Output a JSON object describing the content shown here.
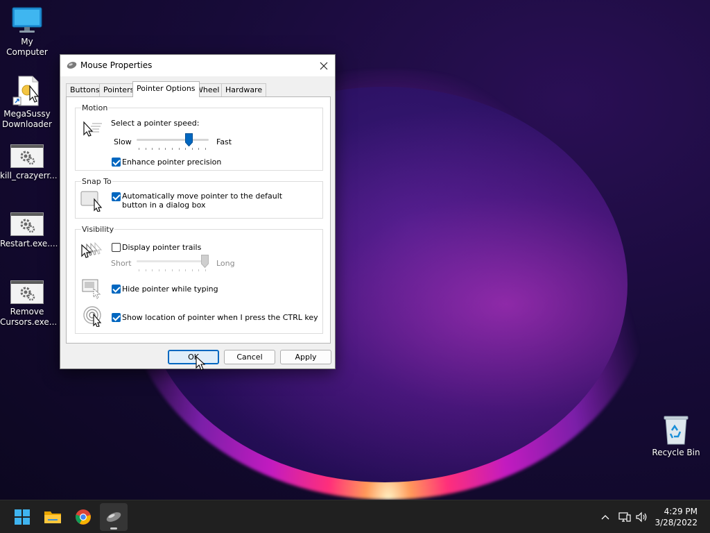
{
  "desktop": {
    "icons": [
      {
        "label": "My Computer"
      },
      {
        "label": "MegaSussy Downloader"
      },
      {
        "label": "kill_crazyerr..."
      },
      {
        "label": "Restart.exe...."
      },
      {
        "label": "Remove Cursors.exe..."
      },
      {
        "label": "Recycle Bin"
      }
    ]
  },
  "dialog": {
    "title": "Mouse Properties",
    "tabs": [
      "Buttons",
      "Pointers",
      "Pointer Options",
      "Wheel",
      "Hardware"
    ],
    "active_tab": "Pointer Options",
    "motion": {
      "group_label": "Motion",
      "speed_label": "Select a pointer speed:",
      "slow_label": "Slow",
      "fast_label": "Fast",
      "speed_level_fraction": 0.75,
      "enhance_label": "Enhance pointer precision",
      "enhance_checked": true
    },
    "snap_to": {
      "group_label": "Snap To",
      "auto_move_label": "Automatically move pointer to the default button in a dialog box",
      "auto_move_checked": true
    },
    "visibility": {
      "group_label": "Visibility",
      "trails_label": "Display pointer trails",
      "trails_checked": false,
      "short_label": "Short",
      "long_label": "Long",
      "trails_level_fraction": 1.0,
      "hide_label": "Hide pointer while typing",
      "hide_checked": true,
      "ctrl_label": "Show location of pointer when I press the CTRL key",
      "ctrl_checked": true
    },
    "buttons": {
      "ok": "OK",
      "cancel": "Cancel",
      "apply": "Apply"
    }
  },
  "taskbar": {
    "time": "4:29 PM",
    "date": "3/28/2022",
    "pinned_icons": [
      "start-icon",
      "file-explorer-icon",
      "chrome-icon",
      "mouse-properties-icon"
    ]
  },
  "colors": {
    "accent": "#0067c0",
    "taskbar": "#202020",
    "dialog_bg": "#f0f0f0"
  }
}
